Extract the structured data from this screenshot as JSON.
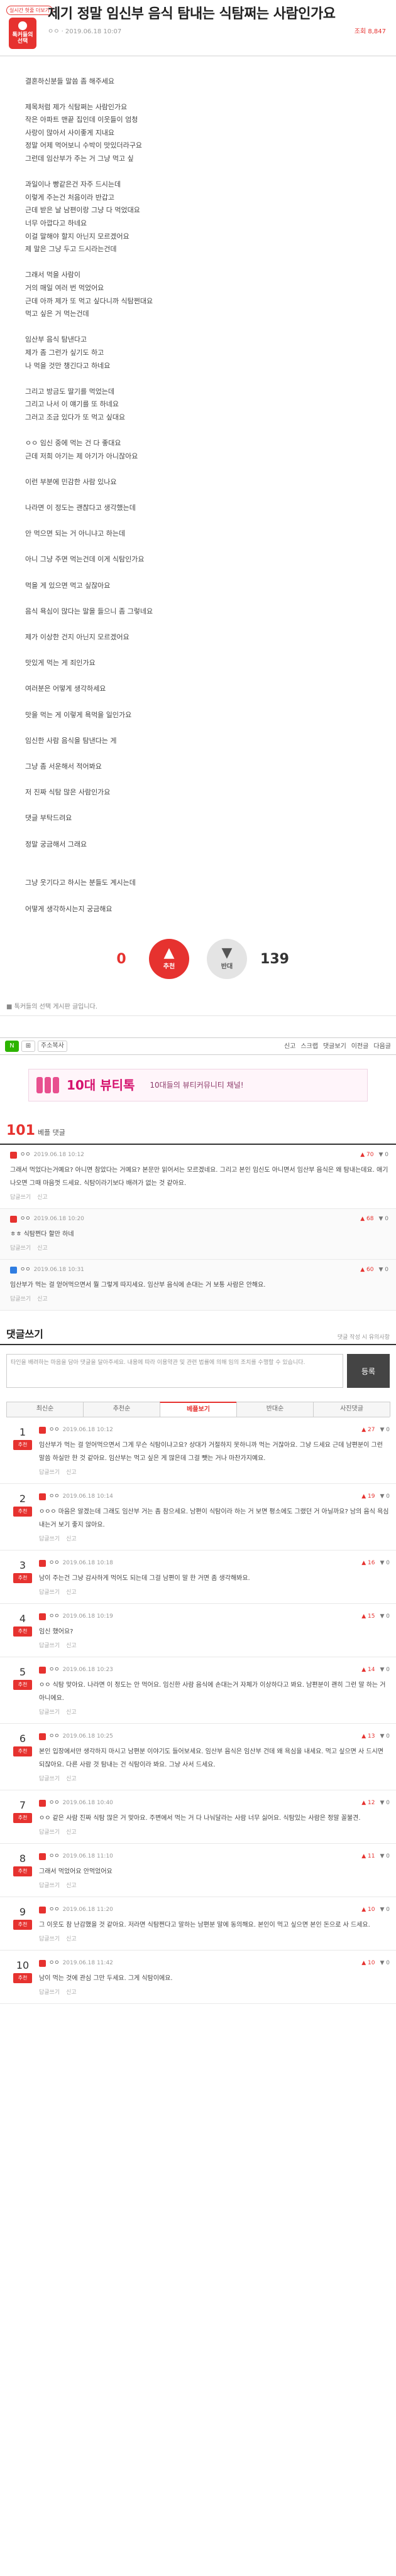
{
  "header": {
    "badge_tag": "실시간 헛줄 더보기",
    "badge_text": "톡커들의 선택",
    "title": "제기 정말 임신부 음식 탐내는 식탐쩌는 사람인가요",
    "author_date": "ㅇㅇ · 2019.06.18 10:07",
    "view_count": "조회 8,847"
  },
  "body_lines": [
    "결혼하신분들 말씀 좀 해주세요",
    "",
    "제목처럼 제가 식탐쩌는 사람인가요",
    "작은 아파트 맨끝 집인데 이웃들이 엄청",
    "사랑이 많아서 사이좋게 지내요",
    "정말 어제 먹어보니 수박이 맛있더라구요",
    "그런데 임산부가 주는 거 그냥 먹고 싶",
    "",
    "과일이나 빵같은건 자주 드시는데",
    "이렇게 주는건 처음이라 반갑고",
    "근데 받은 날 남편이랑 그냥 다 먹었대요",
    "너무 아깝다고 하네요",
    "이걸 말해야 할지 아닌지 모르겠어요",
    "제 말은 그냥 두고 드시라는건데",
    "",
    "그래서 먹을 사람이",
    "거의 매일 여러 번 먹었어요",
    "근데 아까 제가 또 먹고 싶다니까 식탐쩐대요",
    "먹고 싶은 거 먹는건데",
    "",
    "임산부 음식 탐낸다고",
    "제가 좀 그런가 싶기도 하고",
    "나 먹을 것만 챙긴다고 하네요",
    "",
    "그리고 방금도 딸기를 먹었는데",
    "그리고 나서 이 얘기를 또 하네요",
    "그러고 조금 있다가 또 먹고 싶대요",
    "",
    "ㅇㅇ 임신 중에 먹는 건 다 좋대요",
    "근데 저희 아기는 제 아기가 아니잖아요",
    "",
    "이런 부분에 민감한 사람 있나요",
    "",
    "나라면 이 정도는 괜찮다고 생각했는데",
    "",
    "안 먹으면 되는 거 아니냐고 하는데",
    "",
    "아니 그냥 주면 먹는건데 이게 식탐인가요",
    "",
    "먹을 게 있으면 먹고 싶잖아요",
    "",
    "음식 욕심이 많다는 말을 들으니 좀 그렇네요",
    "",
    "제가 이상한 건지 아닌지 모르겠어요",
    "",
    "맛있게 먹는 게 죄인가요",
    "",
    "여러분은 어떻게 생각하세요",
    "",
    "맛을 먹는 게 이렇게 욕먹을 일인가요",
    "",
    "임신한 사람 음식을 탐낸다는 게",
    "",
    "그냥 좀 서운해서 적어봐요",
    "",
    "저 진짜 식탐 많은 사람인가요",
    "",
    "댓글 부탁드려요",
    "",
    "정말 궁금해서 그래요",
    "",
    "",
    "그냥 웃기다고 하시는 분들도 계시는데",
    "",
    "어떻게 생각하시는지 궁금해요"
  ],
  "votes": {
    "up_count": "0",
    "up_label": "추천",
    "down_count": "139",
    "down_label": "반대"
  },
  "notice": "톡커들의 선택 게시판 글입니다.",
  "toolbar": {
    "font_label": "주소복사",
    "right_items": [
      "신고",
      "스크랩",
      "댓글보기",
      "이전글",
      "다음글"
    ]
  },
  "banner": {
    "title": "10대 뷰티톡",
    "subtitle": "10대들의 뷰티커뮤니티 채널!"
  },
  "best": {
    "count": "101",
    "label": "베플 댓글"
  },
  "best_comments": [
    {
      "nick": "ㅇㅇ",
      "date": "2019.06.18 10:12",
      "up": "70",
      "down": "0",
      "blue": false,
      "child": false,
      "text": "그래서 먹었다는거예요? 아니면 참았다는 거예요? 본문만 읽어서는 모르겠네요. 그리고 본인 임신도 아니면서 임산부 음식은 왜 탐내는데요. 애기 나오면 그때 마음껏 드세요. 식탐이라기보다 배려가 없는 것 같아요.",
      "reply": "답글쓰기",
      "report": "신고"
    },
    {
      "nick": "ㅇㅇ",
      "date": "2019.06.18 10:20",
      "up": "68",
      "down": "0",
      "blue": false,
      "child": true,
      "text": "ㅎㅎ 식탐쩐다 할만 하네",
      "reply": "답글쓰기",
      "report": "신고"
    },
    {
      "nick": "ㅇㅇ",
      "date": "2019.06.18 10:31",
      "up": "60",
      "down": "0",
      "blue": true,
      "child": true,
      "text": "임산부가 먹는 걸 얻어먹으면서 뭘 그렇게 따지세요. 임산부 음식에 손대는 거 보통 사람은 안해요.",
      "reply": "답글쓰기",
      "report": "신고"
    }
  ],
  "write": {
    "title": "댓글쓰기",
    "count": "",
    "sub": "댓글 작성 시 유의사항",
    "placeholder": "타인을 배려하는 마음을 담아 댓글을 달아주세요. 내용에 따라 이용약관 및 관련 법률에 의해 임의 조치를 수행할 수 있습니다.",
    "button": "등록"
  },
  "sort_tabs": [
    "최신순",
    "추천순",
    "베플보기",
    "반대순",
    "사진댓글"
  ],
  "comments": [
    {
      "rank": "1",
      "badge": "추천",
      "gray": false,
      "nick": "ㅇㅇ",
      "date": "2019.06.18 10:12",
      "up": "27",
      "down": "0",
      "text": "임산부가 먹는 걸 얻어먹으면서 그게 무슨 식탐이냐고요? 상대가 거절하지 못하니까 먹는 거잖아요. 그냥 드세요 근데 남편분이 그런 말씀 하실만 한 것 같아요. 임산부는 먹고 싶은 게 많은데 그걸 뺏는 거나 마찬가지예요.",
      "reply": "답글쓰기",
      "report": "신고"
    },
    {
      "rank": "2",
      "badge": "추천",
      "gray": false,
      "nick": "ㅇㅇ",
      "date": "2019.06.18 10:14",
      "up": "19",
      "down": "0",
      "text": "ㅇㅇㅇ 마음은 알겠는데 그래도 임산부 거는 좀 참으세요. 남편이 식탐이라 하는 거 보면 평소에도 그랬던 거 아닐까요? 남의 음식 욕심 내는거 보기 좋지 않아요.",
      "reply": "답글쓰기",
      "report": "신고"
    },
    {
      "rank": "3",
      "badge": "추천",
      "gray": false,
      "nick": "ㅇㅇ",
      "date": "2019.06.18 10:18",
      "up": "16",
      "down": "0",
      "text": "남이 주는건 그냥 감사하게 먹어도 되는데 그걸 남편이 말 한 거면 좀 생각해봐요.",
      "reply": "답글쓰기",
      "report": "신고"
    },
    {
      "rank": "4",
      "badge": "추천",
      "gray": false,
      "nick": "ㅇㅇ",
      "date": "2019.06.18 10:19",
      "up": "15",
      "down": "0",
      "text": "임신 했어요?",
      "reply": "답글쓰기",
      "report": "신고"
    },
    {
      "rank": "5",
      "badge": "추천",
      "gray": false,
      "nick": "ㅇㅇ",
      "date": "2019.06.18 10:23",
      "up": "14",
      "down": "0",
      "text": "ㅇㅇ 식탐 맞아요. 나라면 이 정도는 안 먹어요. 임신한 사람 음식에 손대는거 자체가 이상하다고 봐요. 남편분이 괜히 그런 말 하는 거 아니에요.",
      "reply": "답글쓰기",
      "report": "신고"
    },
    {
      "rank": "6",
      "badge": "추천",
      "gray": false,
      "nick": "ㅇㅇ",
      "date": "2019.06.18 10:25",
      "up": "13",
      "down": "0",
      "text": "본인 입장에서만 생각하지 마시고 남편분 이야기도 들어보세요. 임산부 음식은 임산부 건데 왜 욕심을 내세요. 먹고 싶으면 사 드시면 되잖아요. 다른 사람 것 탐내는 건 식탐이라 봐요. 그냥 사서 드세요.",
      "reply": "답글쓰기",
      "report": "신고"
    },
    {
      "rank": "7",
      "badge": "추천",
      "gray": false,
      "nick": "ㅇㅇ",
      "date": "2019.06.18 10:40",
      "up": "12",
      "down": "0",
      "text": "ㅇㅇ 같은 사람 진짜 식탐 많은 거 맞아요. 주변에서 먹는 거 다 나눠달라는 사람 너무 싫어요. 식탐있는 사람은 정말 꼴불견.",
      "reply": "답글쓰기",
      "report": "신고"
    },
    {
      "rank": "8",
      "badge": "추천",
      "gray": false,
      "nick": "ㅇㅇ",
      "date": "2019.06.18 11:10",
      "up": "11",
      "down": "0",
      "text": "그래서 먹었어요 안먹었어요",
      "reply": "답글쓰기",
      "report": "신고"
    },
    {
      "rank": "9",
      "badge": "추천",
      "gray": false,
      "nick": "ㅇㅇ",
      "date": "2019.06.18 11:20",
      "up": "10",
      "down": "0",
      "text": "그 이웃도 참 난감했을 것 같아요. 저라면 식탐쩐다고 말하는 남편분 말에 동의해요. 본인이 먹고 싶으면 본인 돈으로 사 드세요.",
      "reply": "답글쓰기",
      "report": "신고"
    },
    {
      "rank": "10",
      "badge": "추천",
      "gray": false,
      "nick": "ㅇㅇ",
      "date": "2019.06.18 11:42",
      "up": "10",
      "down": "0",
      "text": "남이 먹는 것에 관심 그만 두세요. 그게 식탐이에요.",
      "reply": "답글쓰기",
      "report": "신고"
    }
  ]
}
